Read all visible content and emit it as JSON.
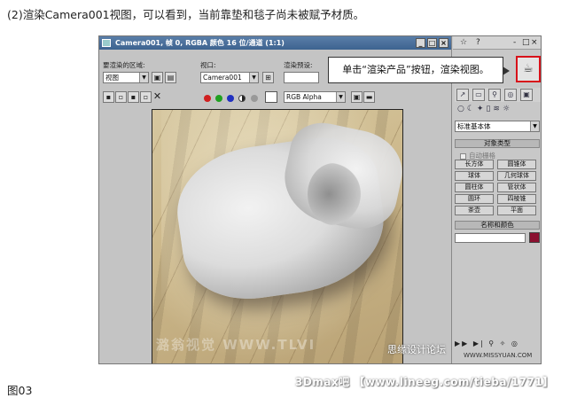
{
  "caption_top": "(2)渲染Camera001视图，可以看到，当前靠垫和毯子尚未被赋予材质。",
  "caption_bottom": "图03",
  "forum_watermark": "3Dmax吧 【www.lineeg.com/tieba/1771】",
  "render_frame": {
    "title": "Camera001, 帧 0, RGBA 颜色 16 位/通道 (1:1)",
    "area_label": "要渲染的区域:",
    "area_value": "视图",
    "viewport_label": "视口:",
    "viewport_value": "Camera001",
    "preset_label": "渲染预设:",
    "channel_value": "RGB Alpha",
    "render_watermark": "潞翁视觉 WWW.TLVI",
    "render_watermark_2": "思缘设计论坛"
  },
  "command_panel": {
    "category_value": "标准基本体",
    "object_type_title": "对象类型",
    "autogrid_label": "自动栅格",
    "buttons": [
      "长方体",
      "圆锥体",
      "球体",
      "几何球体",
      "圆柱体",
      "管状体",
      "圆环",
      "四棱锥",
      "茶壶",
      "平面"
    ],
    "name_color_title": "名称和颜色",
    "site_watermark": "WWW.MISSYUAN.COM"
  },
  "tooltip_text": "单击“渲染产品”按钮，渲染视图。",
  "colors": {
    "highlight_border": "#d8121a",
    "color_chip": "#8b1030"
  }
}
